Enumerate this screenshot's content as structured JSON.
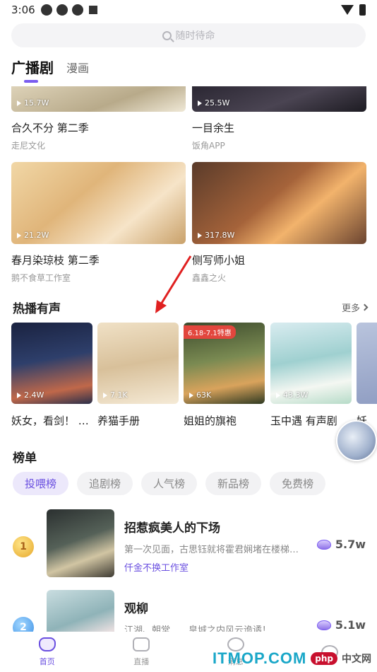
{
  "status_bar": {
    "time": "3:06"
  },
  "search": {
    "placeholder": "随时待命"
  },
  "tabs": {
    "active": "广播剧",
    "other": "漫画"
  },
  "grid": [
    {
      "title": "合久不分 第二季",
      "author": "走尼文化",
      "plays": "15.7W"
    },
    {
      "title": "一目余生",
      "author": "饭角APP",
      "plays": "25.5W"
    },
    {
      "title": "春月染琼枝  第二季",
      "author": "鹅不食草工作室",
      "plays": "21.2W"
    },
    {
      "title": "侧写师小姐",
      "author": "鑫鑫之火",
      "plays": "317.8W"
    }
  ],
  "hot_section": {
    "title": "热播有声",
    "more": "更多"
  },
  "hot": [
    {
      "title": "妖女，看剑！ …",
      "plays": "2.4W"
    },
    {
      "title": "养猫手册",
      "plays": "7.1K"
    },
    {
      "title": "姐姐的旗袍",
      "plays": "63K",
      "badge": "6.18-7.1特惠"
    },
    {
      "title": "玉中遇 有声剧",
      "plays": "43.3W"
    },
    {
      "title": "妖",
      "plays": ""
    }
  ],
  "rank_section": {
    "title": "榜单"
  },
  "rank_tabs": [
    "投喂榜",
    "追剧榜",
    "人气榜",
    "新品榜",
    "免费榜"
  ],
  "rank": [
    {
      "no": "1",
      "title": "招惹疯美人的下场",
      "desc": "第一次见面，古思钰就将霍君娴堵在楼梯…",
      "author": "仟金不换工作室",
      "heat": "5.7w"
    },
    {
      "no": "2",
      "title": "观柳",
      "desc": "江湖、朝堂……皇城之内风云诡谲！",
      "author": "",
      "heat": "5.1w"
    }
  ],
  "nav": [
    "首页",
    "直播",
    "消息",
    ""
  ],
  "watermark": {
    "logo": "ITMOP.COM",
    "php": "php",
    "cn": "中文网"
  },
  "colors": {
    "accent": "#6a4fe0",
    "annotation_arrow": "#e02020"
  },
  "icons": [
    "search-icon",
    "play-icon",
    "chevron-right-icon",
    "medal-icon",
    "gem-icon",
    "home-icon",
    "live-icon",
    "message-icon",
    "profile-icon"
  ]
}
